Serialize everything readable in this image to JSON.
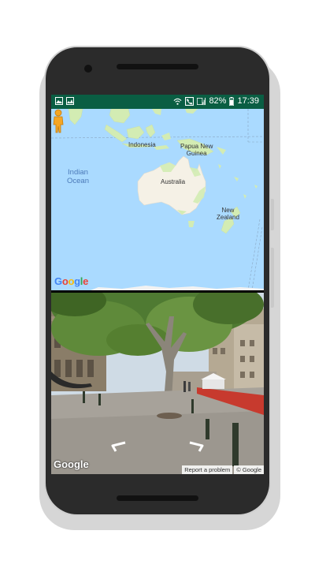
{
  "status_bar": {
    "battery": "82%",
    "time": "17:39",
    "icons": [
      "image-icon",
      "photo-icon",
      "wifi-icon",
      "call-icon",
      "signal-icon",
      "battery-icon"
    ]
  },
  "map": {
    "labels": {
      "indonesia": "Indonesia",
      "papua": "Papua New\nGuinea",
      "australia": "Australia",
      "nz": "New\nZealand",
      "ocean": "Indian\nOcean"
    },
    "logo": "Google",
    "colors": {
      "water": "#aadaff",
      "land": "#d3ecb3",
      "australia": "#f5f1e6",
      "pegman": "#f5a623"
    }
  },
  "street_view": {
    "logo": "Google",
    "report_link": "Report a problem",
    "copyright": "© Google"
  },
  "colors": {
    "status_bar": "#0a5e43"
  }
}
